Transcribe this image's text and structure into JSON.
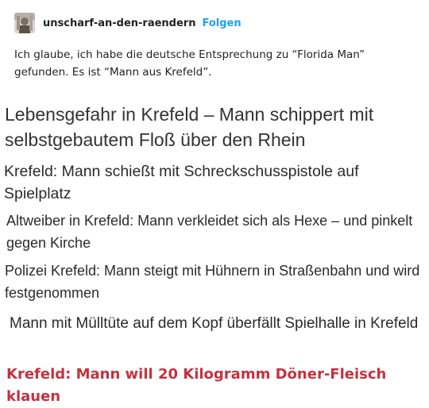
{
  "post": {
    "username": "unscharf-an-den-raendern",
    "follow_label": "Folgen",
    "caption": "Ich glaube, ich habe die deutsche Entsprechung zu “Florida Man” gefunden. Es ist “Mann aus Krefeld”."
  },
  "headlines": [
    "Lebensgefahr in Krefeld – Mann schippert mit selbstgebautem Floß über den Rhein",
    "Krefeld: Mann schießt mit Schreckschusspistole auf Spielplatz",
    "Altweiber in Krefeld: Mann verkleidet sich als Hexe – und pinkelt gegen Kirche",
    "Polizei Krefeld: Mann steigt mit Hühnern in Straßenbahn und wird festgenommen",
    "Mann mit Mülltüte auf dem Kopf überfällt Spielhalle in Krefeld",
    "Krefeld: Mann will 20 Kilogramm Döner-Fleisch klauen"
  ],
  "colors": {
    "follow": "#1da1f2",
    "last_headline": "#c4323f"
  },
  "icons": {
    "avatar": "user-avatar"
  }
}
